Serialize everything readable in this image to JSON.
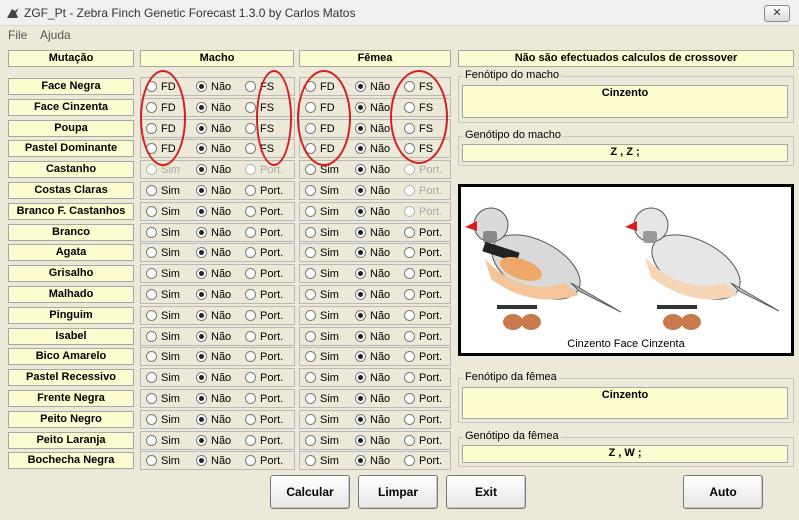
{
  "window": {
    "title": "ZGF_Pt - Zebra Finch Genetic Forecast 1.3.0 by Carlos Matos",
    "close_label": "✕"
  },
  "menu": [
    "File",
    "Ajuda"
  ],
  "headers": {
    "mutation": "Mutação",
    "male": "Macho",
    "female": "Fêmea",
    "notice": "Não são efectuados calculos de crossover"
  },
  "mutations": [
    {
      "name": "Face Negra",
      "opts": [
        "FD",
        "Não",
        "FS"
      ],
      "male": 1,
      "female": 1,
      "male_disabled": [],
      "female_disabled": []
    },
    {
      "name": "Face Cinzenta",
      "opts": [
        "FD",
        "Não",
        "FS"
      ],
      "male": 1,
      "female": 1,
      "male_disabled": [],
      "female_disabled": []
    },
    {
      "name": "Poupa",
      "opts": [
        "FD",
        "Não",
        "FS"
      ],
      "male": 1,
      "female": 1,
      "male_disabled": [],
      "female_disabled": []
    },
    {
      "name": "Pastel Dominante",
      "opts": [
        "FD",
        "Não",
        "FS"
      ],
      "male": 1,
      "female": 1,
      "male_disabled": [],
      "female_disabled": []
    },
    {
      "name": "Castanho",
      "opts": [
        "Sim",
        "Não",
        "Port."
      ],
      "male": 1,
      "female": 1,
      "male_disabled": [
        0,
        2
      ],
      "female_disabled": [
        2
      ]
    },
    {
      "name": "Costas Claras",
      "opts": [
        "Sim",
        "Não",
        "Port."
      ],
      "male": 1,
      "female": 1,
      "male_disabled": [],
      "female_disabled": [
        2
      ]
    },
    {
      "name": "Branco F. Castanhos",
      "opts": [
        "Sim",
        "Não",
        "Port."
      ],
      "male": 1,
      "female": 1,
      "male_disabled": [],
      "female_disabled": [
        2
      ]
    },
    {
      "name": "Branco",
      "opts": [
        "Sim",
        "Não",
        "Port."
      ],
      "male": 1,
      "female": 1,
      "male_disabled": [],
      "female_disabled": []
    },
    {
      "name": "Agata",
      "opts": [
        "Sim",
        "Não",
        "Port."
      ],
      "male": 1,
      "female": 1,
      "male_disabled": [],
      "female_disabled": []
    },
    {
      "name": "Grisalho",
      "opts": [
        "Sim",
        "Não",
        "Port."
      ],
      "male": 1,
      "female": 1,
      "male_disabled": [],
      "female_disabled": []
    },
    {
      "name": "Malhado",
      "opts": [
        "Sim",
        "Não",
        "Port."
      ],
      "male": 1,
      "female": 1,
      "male_disabled": [],
      "female_disabled": []
    },
    {
      "name": "Pinguim",
      "opts": [
        "Sim",
        "Não",
        "Port."
      ],
      "male": 1,
      "female": 1,
      "male_disabled": [],
      "female_disabled": []
    },
    {
      "name": "Isabel",
      "opts": [
        "Sim",
        "Não",
        "Port."
      ],
      "male": 1,
      "female": 1,
      "male_disabled": [],
      "female_disabled": []
    },
    {
      "name": "Bico Amarelo",
      "opts": [
        "Sim",
        "Não",
        "Port."
      ],
      "male": 1,
      "female": 1,
      "male_disabled": [],
      "female_disabled": []
    },
    {
      "name": "Pastel Recessivo",
      "opts": [
        "Sim",
        "Não",
        "Port."
      ],
      "male": 1,
      "female": 1,
      "male_disabled": [],
      "female_disabled": []
    },
    {
      "name": "Frente Negra",
      "opts": [
        "Sim",
        "Não",
        "Port."
      ],
      "male": 1,
      "female": 1,
      "male_disabled": [],
      "female_disabled": []
    },
    {
      "name": "Peito Negro",
      "opts": [
        "Sim",
        "Não",
        "Port."
      ],
      "male": 1,
      "female": 1,
      "male_disabled": [],
      "female_disabled": []
    },
    {
      "name": "Peito Laranja",
      "opts": [
        "Sim",
        "Não",
        "Port."
      ],
      "male": 1,
      "female": 1,
      "male_disabled": [],
      "female_disabled": []
    },
    {
      "name": "Bochecha Negra",
      "opts": [
        "Sim",
        "Não",
        "Port."
      ],
      "male": 1,
      "female": 1,
      "male_disabled": [],
      "female_disabled": []
    }
  ],
  "male_phenotype": {
    "label": "Fenótipo do macho",
    "value": "Cinzento"
  },
  "male_genotype": {
    "label": "Genótipo do macho",
    "value": "Z , Z ;"
  },
  "picture": {
    "caption": "Cinzento Face Cinzenta"
  },
  "female_phenotype": {
    "label": "Fenótipo da fêmea",
    "value": "Cinzento"
  },
  "female_genotype": {
    "label": "Genótipo da fêmea",
    "value": "Z , W ;"
  },
  "buttons": {
    "calculate": "Calcular",
    "clear": "Limpar",
    "exit": "Exit",
    "auto": "Auto"
  },
  "colors": {
    "label_bg": "#fcfcd0",
    "window_bg": "#ece9d8",
    "annotation": "#d42020"
  }
}
